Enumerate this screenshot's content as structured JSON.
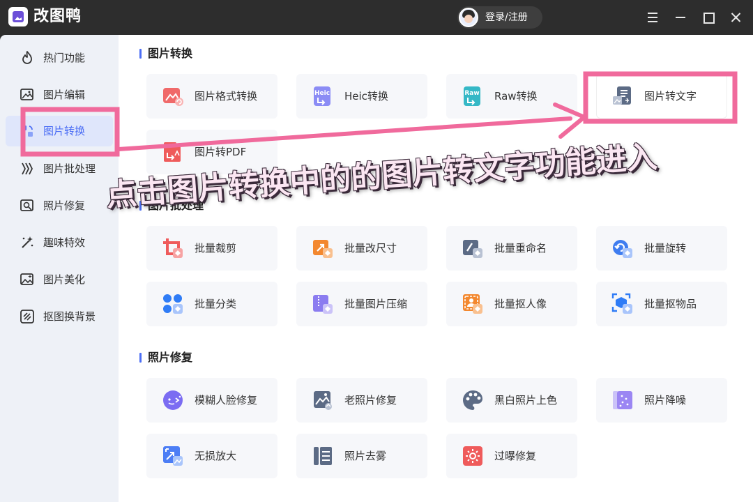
{
  "app": {
    "name": "改图鸭",
    "login_label": "登录/注册"
  },
  "sidebar": {
    "items": [
      {
        "label": "热门功能",
        "icon": "flame-icon"
      },
      {
        "label": "图片编辑",
        "icon": "image-edit-icon"
      },
      {
        "label": "图片转换",
        "icon": "image-convert-icon",
        "active": true
      },
      {
        "label": "图片批处理",
        "icon": "layers-icon"
      },
      {
        "label": "照片修复",
        "icon": "photo-repair-icon"
      },
      {
        "label": "趣味特效",
        "icon": "magic-wand-icon"
      },
      {
        "label": "图片美化",
        "icon": "image-beautify-icon"
      },
      {
        "label": "抠图换背景",
        "icon": "cutout-icon"
      }
    ]
  },
  "sections": [
    {
      "title": "图片转换",
      "cards": [
        {
          "label": "图片格式转换",
          "icon": "image-format-icon",
          "color": "#f06a6a"
        },
        {
          "label": "Heic转换",
          "icon": "heic-file-icon",
          "color": "#8b8cf5"
        },
        {
          "label": "Raw转换",
          "icon": "raw-file-icon",
          "color": "#35b8c6"
        },
        {
          "label": "图片转文字",
          "icon": "image-to-text-icon",
          "color": "#5c6b85"
        },
        {
          "label": "图片转PDF",
          "icon": "pdf-file-icon",
          "color": "#ef5b5b"
        }
      ]
    },
    {
      "title": "图片批处理",
      "cards": [
        {
          "label": "批量裁剪",
          "icon": "batch-crop-icon",
          "color": "#ef5b5b"
        },
        {
          "label": "批量改尺寸",
          "icon": "batch-resize-icon",
          "color": "#f3882f"
        },
        {
          "label": "批量重命名",
          "icon": "batch-rename-icon",
          "color": "#5c6b85"
        },
        {
          "label": "批量旋转",
          "icon": "batch-rotate-icon",
          "color": "#3f7df0"
        },
        {
          "label": "批量分类",
          "icon": "batch-classify-icon",
          "color": "#2f7cf6"
        },
        {
          "label": "批量图片压缩",
          "icon": "batch-compress-icon",
          "color": "#8b7cf0"
        },
        {
          "label": "批量抠人像",
          "icon": "batch-portrait-icon",
          "color": "#f3882f"
        },
        {
          "label": "批量抠物品",
          "icon": "batch-object-icon",
          "color": "#2f7cf6"
        }
      ]
    },
    {
      "title": "照片修复",
      "cards": [
        {
          "label": "模糊人脸修复",
          "icon": "face-repair-icon",
          "color": "#7b6cf2"
        },
        {
          "label": "老照片修复",
          "icon": "old-photo-icon",
          "color": "#5c6b85"
        },
        {
          "label": "黑白照片上色",
          "icon": "palette-icon",
          "color": "#5c6b85"
        },
        {
          "label": "照片降噪",
          "icon": "denoise-icon",
          "color": "#9b86f3"
        },
        {
          "label": "无损放大",
          "icon": "upscale-icon",
          "color": "#4c7ef5"
        },
        {
          "label": "照片去雾",
          "icon": "dehaze-icon",
          "color": "#5c6b85"
        },
        {
          "label": "过曝修复",
          "icon": "overexposure-icon",
          "color": "#ef5b5b"
        }
      ]
    }
  ],
  "annotation": {
    "caption": "点击图片转换中的的图片转文字功能进入",
    "color": "#f06a9c"
  }
}
